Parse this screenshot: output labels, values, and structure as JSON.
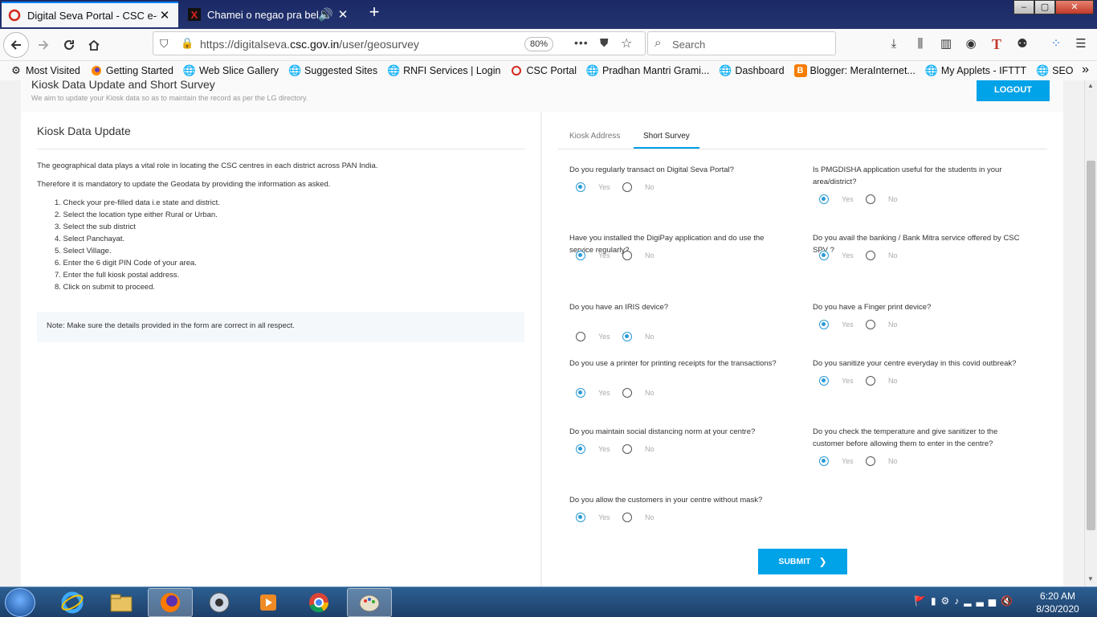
{
  "browser": {
    "tabs": [
      {
        "title": "Digital Seva Portal - CSC e-Gov",
        "close": "✕"
      },
      {
        "title": "Chamei o negao pra beber c",
        "close": "✕"
      }
    ],
    "new_tab": "+",
    "url_prefix": "https://digitalseva.",
    "url_domain": "csc.gov.in",
    "url_path": "/user/geosurvey",
    "zoom": "80%",
    "search_placeholder": "Search"
  },
  "bookmarks": [
    {
      "label": "Most Visited",
      "icon": "gear-icon"
    },
    {
      "label": "Getting Started",
      "icon": "firefox-icon"
    },
    {
      "label": "Web Slice Gallery",
      "icon": "globe-icon"
    },
    {
      "label": "Suggested Sites",
      "icon": "globe-icon"
    },
    {
      "label": "RNFI Services | Login",
      "icon": "globe-icon"
    },
    {
      "label": "CSC Portal",
      "icon": "csc-icon"
    },
    {
      "label": "Pradhan Mantri Grami...",
      "icon": "globe-icon"
    },
    {
      "label": "Dashboard",
      "icon": "globe-icon"
    },
    {
      "label": "Blogger: MeraInternet...",
      "icon": "blogger-icon"
    },
    {
      "label": "My Applets - IFTTT",
      "icon": "globe-icon"
    },
    {
      "label": "SEO",
      "icon": "globe-icon"
    }
  ],
  "header": {
    "title": "Kiosk Data Update and Short Survey",
    "subtitle": "We aim to update your Kiosk data so as to maintain the record as per the LG directory.",
    "logout": "LOGOUT"
  },
  "left": {
    "title": "Kiosk Data Update",
    "para1": "The geographical data plays a vital role in locating the CSC centres in each district across PAN India.",
    "para2": "Therefore it is mandatory to update the Geodata by providing the information as asked.",
    "steps": [
      "1. Check your pre-filled data i.e state and district.",
      "2. Select the location type either Rural or Urban.",
      "3. Select the sub district",
      "4. Select Panchayat.",
      "5. Select Village.",
      "6. Enter the 6 digit PIN Code of your area.",
      "7. Enter the full kiosk postal address.",
      "8. Click on submit to proceed."
    ],
    "note": "Note: Make sure the details provided in the form are correct in all respect."
  },
  "survey": {
    "tabs": [
      "Kiosk Address",
      "Short Survey"
    ],
    "yes": "Yes",
    "no": "No",
    "questions": [
      {
        "text": "Do you regularly transact on Digital Seva Portal?",
        "answer": "Yes"
      },
      {
        "text": "Is PMGDISHA application useful for the students in your area/district?",
        "answer": "Yes"
      },
      {
        "text": "Have you installed the DigiPay application and do use the service regularly?",
        "answer": "Yes"
      },
      {
        "text": "Do you avail the banking / Bank Mitra service offered by CSC SPV ?",
        "answer": "Yes"
      },
      {
        "text": "Do you have an IRIS device?",
        "answer": "No"
      },
      {
        "text": "Do you have a Finger print device?",
        "answer": "Yes"
      },
      {
        "text": "Do you use a printer for printing receipts for the transactions?",
        "answer": "Yes"
      },
      {
        "text": "Do you sanitize your centre everyday in this covid outbreak?",
        "answer": "Yes"
      },
      {
        "text": "Do you maintain social distancing norm at your centre?",
        "answer": "Yes"
      },
      {
        "text": "Do you check the temperature and give sanitizer to the customer before allowing them to enter in the centre?",
        "answer": "Yes"
      },
      {
        "text": "Do you allow the customers in your centre without mask?",
        "answer": "Yes"
      }
    ],
    "submit": "SUBMIT"
  },
  "taskbar": {
    "time": "6:20 AM",
    "date": "8/30/2020"
  },
  "colors": {
    "accent": "#00a2e8",
    "radio": "#2b9ad6"
  }
}
